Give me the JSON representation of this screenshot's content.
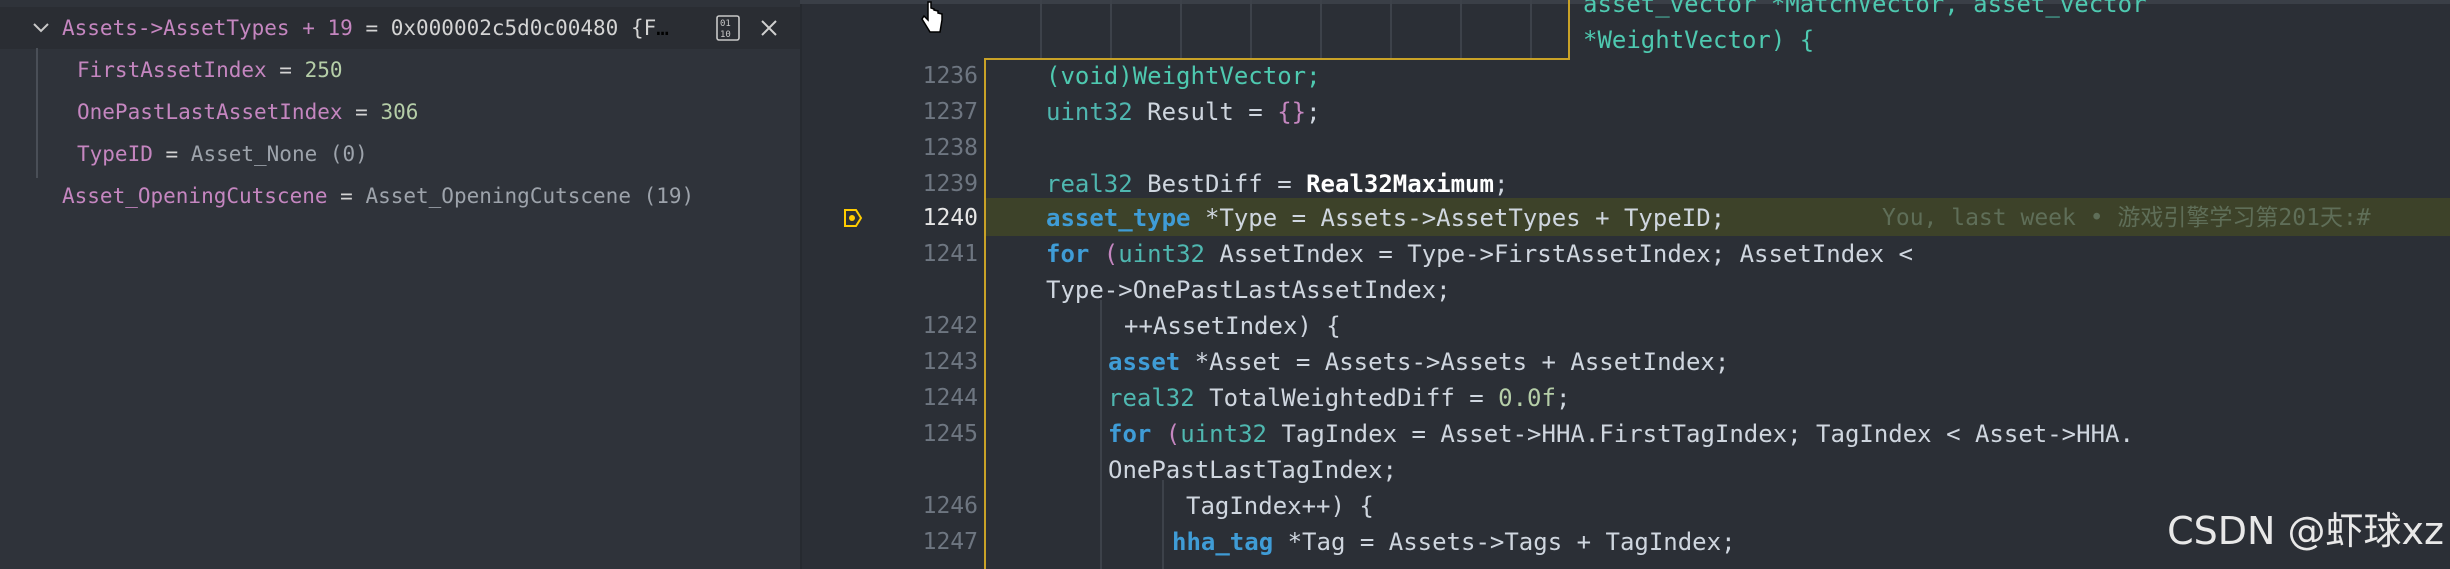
{
  "hover_panel": {
    "header": {
      "expression": "Assets->AssetTypes + 19",
      "equals": " = ",
      "address": "0x000002c5d0c00480 {F..."
    },
    "children": [
      {
        "name": "FirstAssetIndex",
        "value": "250"
      },
      {
        "name": "OnePastLastAssetIndex",
        "value": "306"
      },
      {
        "name": "TypeID",
        "value": "Asset_None (0)"
      }
    ],
    "sibling": {
      "name": "Asset_OpeningCutscene",
      "value": "Asset_OpeningCutscene (19)"
    }
  },
  "editor": {
    "top_lines": {
      "fragment1": "asset_vector *MatchVector, asset_vector",
      "fragment2": "*WeightVector) {"
    },
    "line_numbers": [
      "1236",
      "1237",
      "1238",
      "1239",
      "1240",
      "1241",
      "",
      "1242",
      "1243",
      "1244",
      "1245",
      "",
      "1246",
      "1247"
    ],
    "blame": "You, last week • 游戏引擎学习第201天:#",
    "code": {
      "l1236": "(void)WeightVector;",
      "l1237a": "uint32",
      "l1237b": " Result = ",
      "l1237c": "{}",
      "l1237d": ";",
      "l1239a": "real32",
      "l1239b": " BestDiff = ",
      "l1239c": "Real32Maximum",
      "l1239d": ";",
      "l1240a": "asset_type",
      "l1240b": " *Type = Assets->AssetTypes + TypeID;",
      "l1241a": "for",
      "l1241b": " (",
      "l1241c": "uint32",
      "l1241d": " AssetIndex = Type->FirstAssetIndex; AssetIndex < ",
      "l1241e": "Type->OnePastLastAssetIndex;",
      "l1242": "++AssetIndex) {",
      "l1243a": "asset",
      "l1243b": " *Asset = Assets->Assets + AssetIndex;",
      "l1244a": "real32",
      "l1244b": " TotalWeightedDiff = ",
      "l1244c": "0.0f",
      "l1244d": ";",
      "l1245a": "for",
      "l1245b": " (",
      "l1245c": "uint32",
      "l1245d": " TagIndex = Asset->HHA.FirstTagIndex; TagIndex < Asset->HHA.",
      "l1245e": "OnePastLastTagIndex;",
      "l1246": "TagIndex++) {",
      "l1247a": "hha_tag",
      "l1247b": " *Tag = Assets->Tags + TagIndex;"
    }
  },
  "watermark": "CSDN @虾球xz"
}
